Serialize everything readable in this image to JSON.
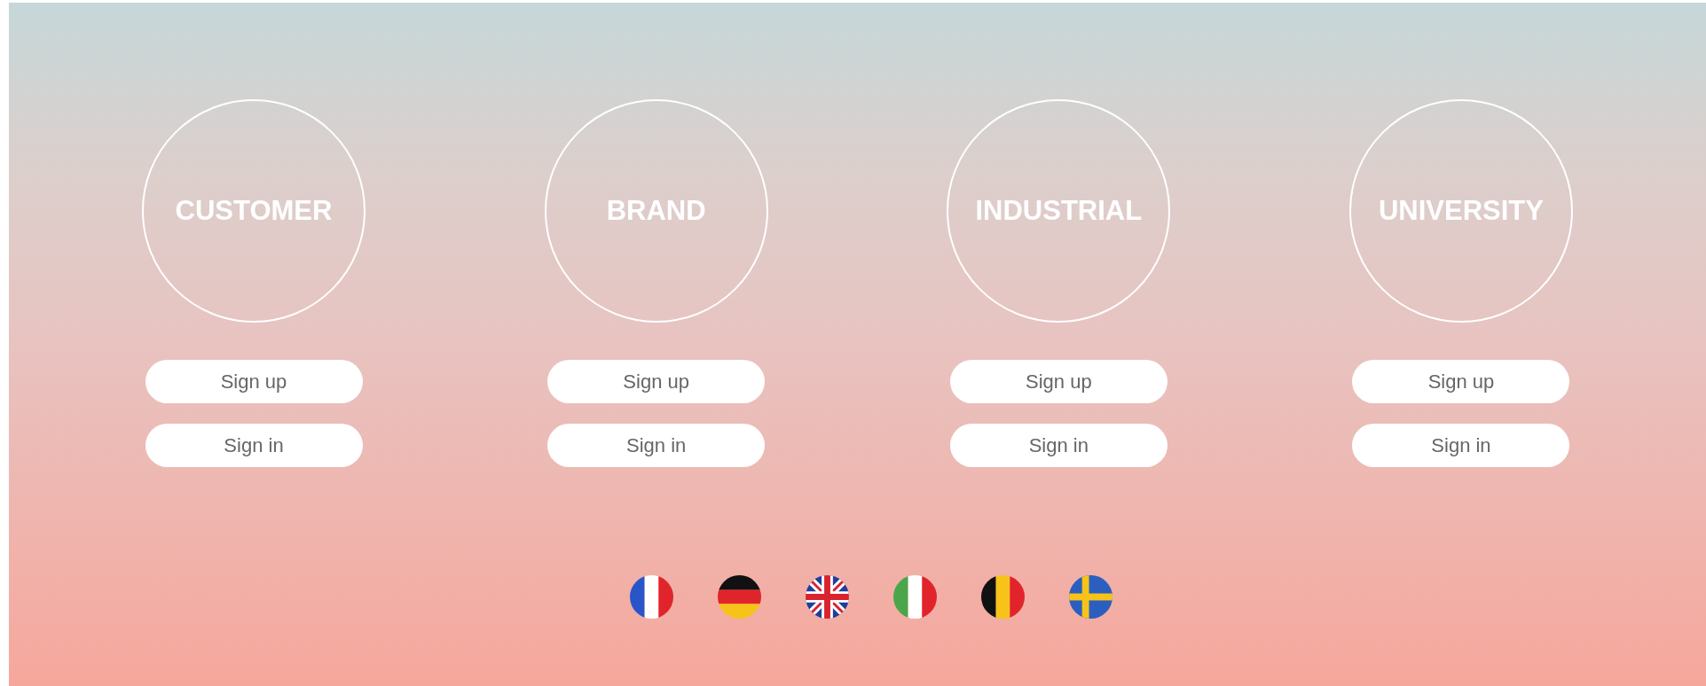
{
  "groups": [
    {
      "label": "CUSTOMER",
      "buttons": [
        "Sign up",
        "Sign in"
      ]
    },
    {
      "label": "BRAND",
      "buttons": [
        "Sign up",
        "Sign in"
      ]
    },
    {
      "label": "INDUSTRIAL",
      "buttons": [
        "Sign up",
        "Sign in"
      ]
    },
    {
      "label": "UNIVERSITY",
      "buttons": [
        "Sign up",
        "Sign in"
      ]
    }
  ],
  "languages": [
    {
      "kind": "fr"
    },
    {
      "kind": "de"
    },
    {
      "kind": "gb"
    },
    {
      "kind": "it"
    },
    {
      "kind": "be"
    },
    {
      "kind": "se"
    }
  ]
}
